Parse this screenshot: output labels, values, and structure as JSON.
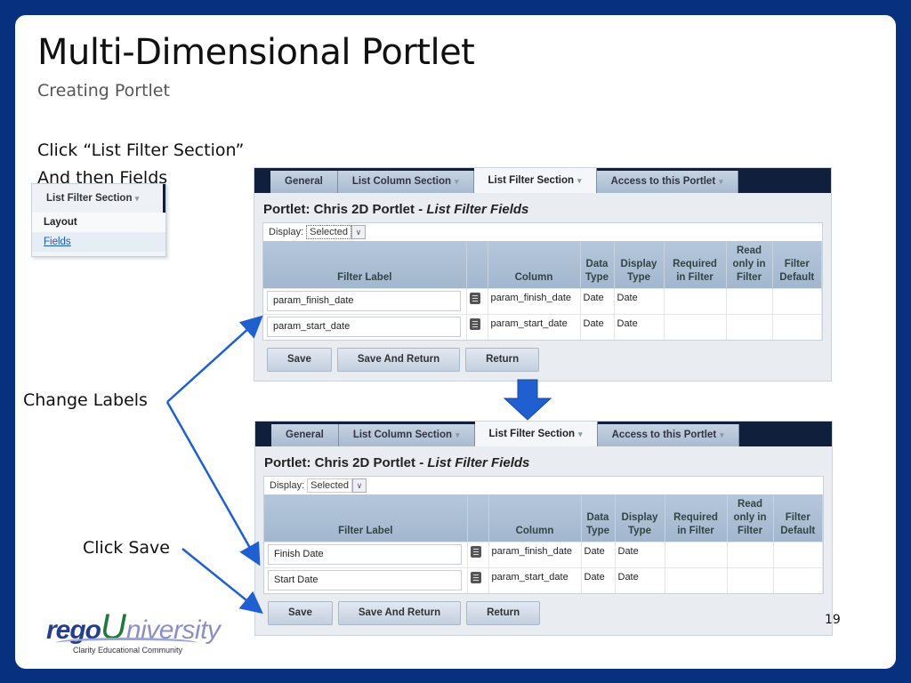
{
  "slide": {
    "title": "Multi-Dimensional Portlet",
    "subtitle": "Creating Portlet",
    "instruction_line1": "Click “List Filter Section”",
    "instruction_line2": "And then Fields",
    "note_change_labels": "Change Labels",
    "note_click_save": "Click Save",
    "page_number": "19",
    "accent_color": "#07307f",
    "arrow_color": "#1f5fcf"
  },
  "menu": {
    "header": "List Filter Section",
    "items": [
      {
        "label": "Layout"
      },
      {
        "label": "Fields"
      }
    ]
  },
  "tabs": [
    {
      "label": "General",
      "has_caret": false
    },
    {
      "label": "List Column Section",
      "has_caret": true
    },
    {
      "label": "List Filter Section",
      "has_caret": true,
      "active": true
    },
    {
      "label": "Access to this Portlet",
      "has_caret": true
    }
  ],
  "caret": "▾",
  "portlet": {
    "title_prefix": "Portlet: Chris 2D Portlet - ",
    "title_italic": "List Filter Fields",
    "display_label": "Display:",
    "display_value": "Selected",
    "display_caret": "∨"
  },
  "columns": [
    "Filter Label",
    "",
    "Column",
    "Data Type",
    "Display Type",
    "Required in Filter",
    "Read only in Filter",
    "Filter Default"
  ],
  "before": {
    "rows": [
      {
        "label": "param_finish_date",
        "column": "param_finish_date",
        "data_type": "Date",
        "display_type": "Date"
      },
      {
        "label": "param_start_date",
        "column": "param_start_date",
        "data_type": "Date",
        "display_type": "Date"
      }
    ]
  },
  "after": {
    "rows": [
      {
        "label": "Finish Date",
        "column": "param_finish_date",
        "data_type": "Date",
        "display_type": "Date"
      },
      {
        "label": "Start Date",
        "column": "param_start_date",
        "data_type": "Date",
        "display_type": "Date"
      }
    ]
  },
  "buttons": {
    "save": "Save",
    "save_and_return": "Save And Return",
    "return": "Return"
  },
  "logo": {
    "rego": "rego",
    "u": "U",
    "niversity": "niversity",
    "tagline": "Clarity Educational Community"
  }
}
